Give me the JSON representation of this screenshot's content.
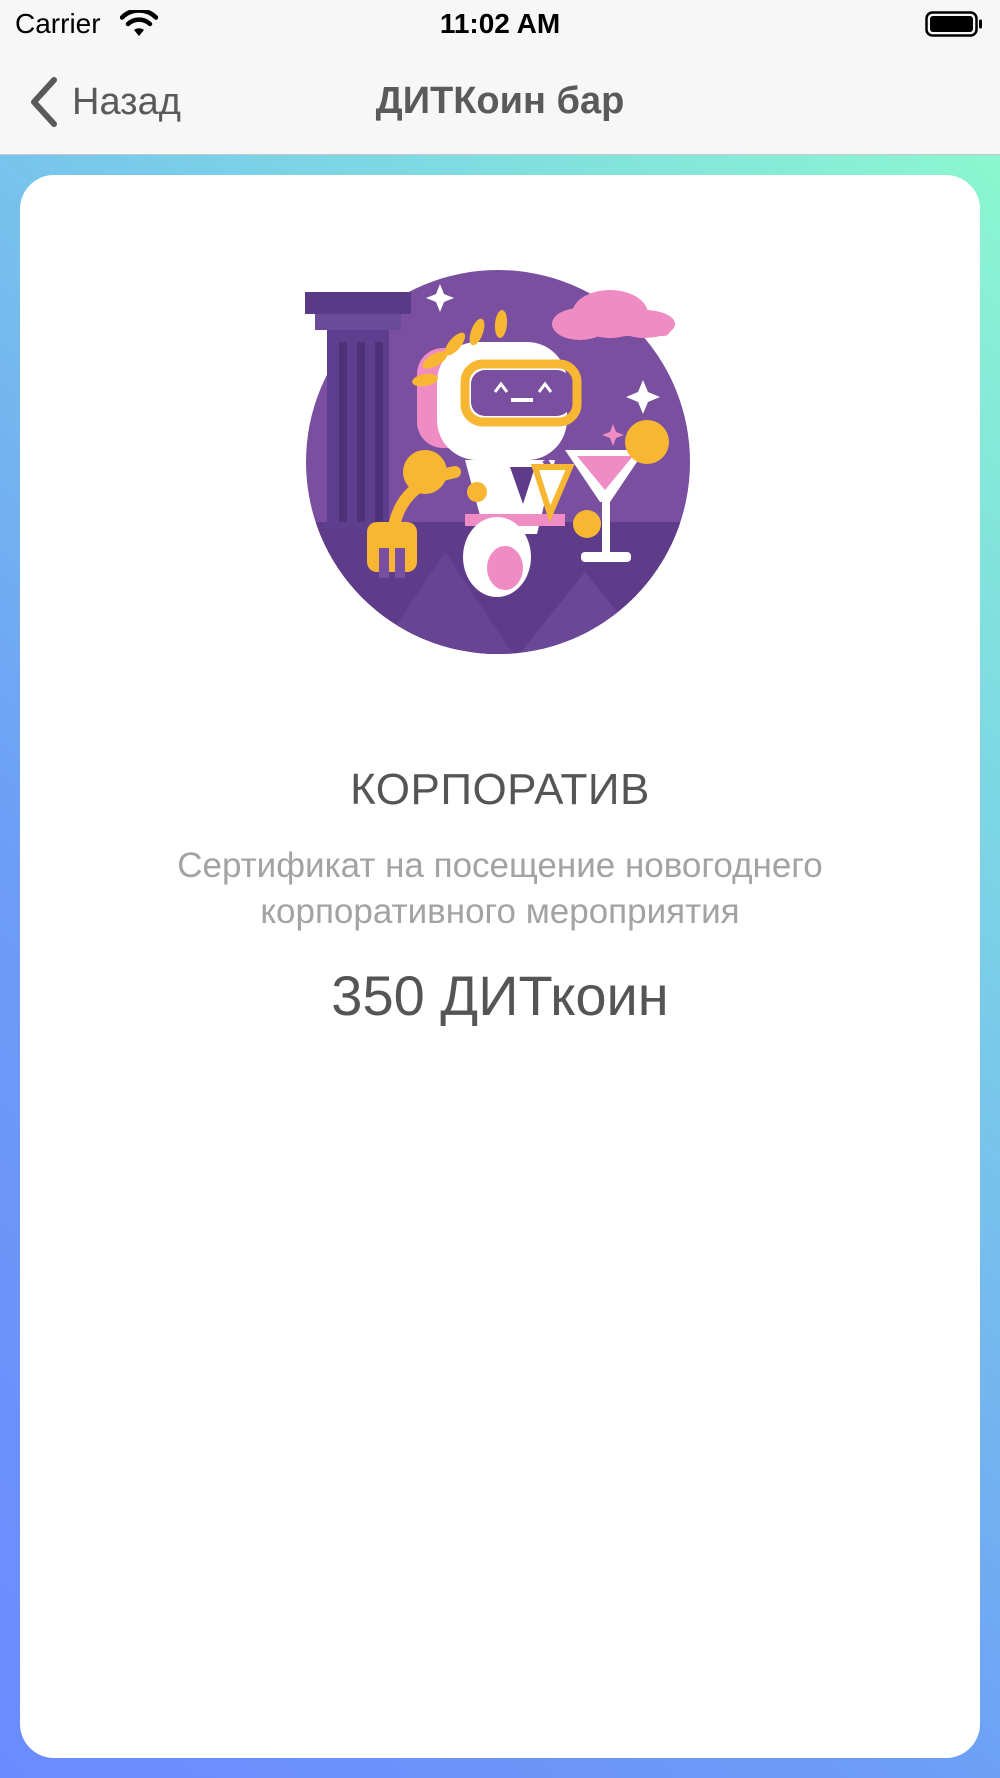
{
  "status_bar": {
    "carrier": "Carrier",
    "time": "11:02 AM",
    "icons": [
      "wifi-icon",
      "battery-icon"
    ]
  },
  "nav_bar": {
    "back_label": "Назад",
    "title": "ДИТКоин бар",
    "back_icon": "chevron-left-icon"
  },
  "item": {
    "illustration": "robot-corporate-party-illustration",
    "title": "КОРПОРАТИВ",
    "description": "Сертификат на посещение новогоднего корпоративного мероприятия",
    "price": "350 ДИТкоин"
  },
  "colors": {
    "gradient_start": "#8cf7cf",
    "gradient_end": "#6a8bff",
    "card": "#ffffff",
    "text_primary": "#555555",
    "text_secondary": "#a3a3a3",
    "illustration_bg": "#7b4fa0",
    "accent_yellow": "#f7b733",
    "accent_pink": "#ef8cc4"
  }
}
